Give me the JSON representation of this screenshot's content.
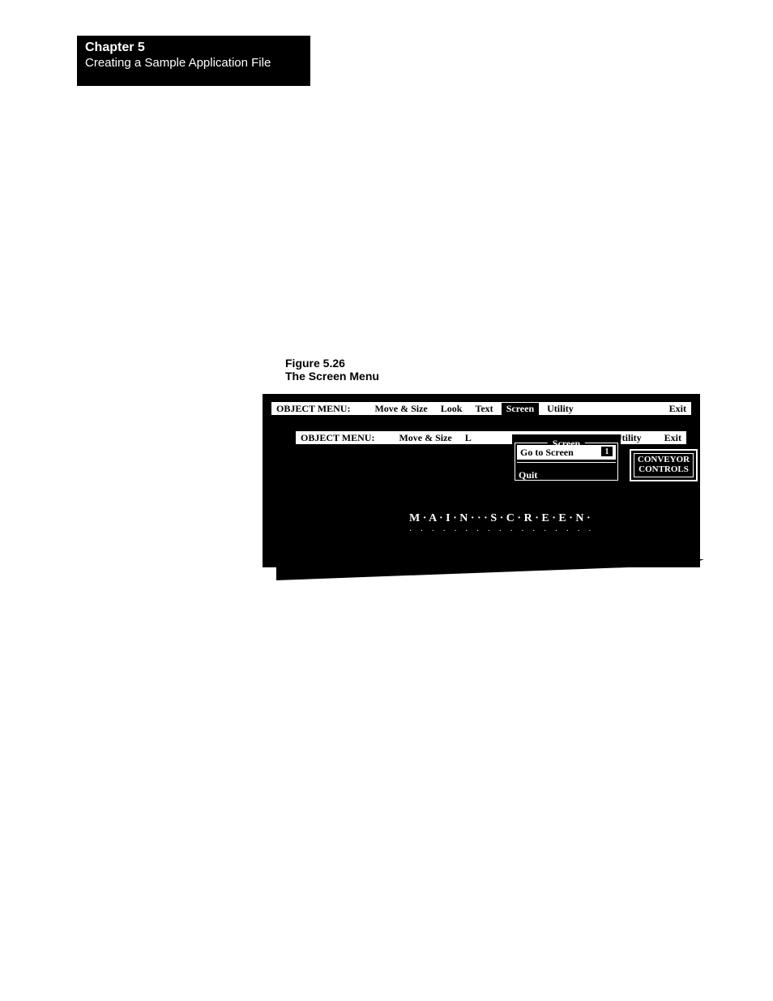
{
  "chapter": {
    "title": "Chapter 5",
    "subtitle": "Creating a Sample Application File"
  },
  "figure": {
    "number": "Figure 5.26",
    "title": "The Screen Menu"
  },
  "outer_menu": {
    "label": "OBJECT MENU:",
    "items": [
      "Move & Size",
      "Look",
      "Text",
      "Screen",
      "Utility",
      "Exit"
    ],
    "highlighted": "Screen"
  },
  "inner_menu": {
    "label": "OBJECT MENU:",
    "items": [
      "Move & Size",
      "L",
      "Utility",
      "Exit"
    ]
  },
  "dropdown": {
    "title": "Screen",
    "items": [
      {
        "label": "Go to Screen",
        "value": "1",
        "selected": true
      },
      {
        "label": "Quit",
        "selected": false
      }
    ]
  },
  "button": {
    "line1": "CONVEYOR",
    "line2": "CONTROLS"
  },
  "main_title": "M · A · I · N ·  ·  · S · C · R · E · E · N ·",
  "dots": "· · · · · · · · · · · · · · · · · · · · · · · · · · · · · · · · · · · · · · · · · · ·"
}
